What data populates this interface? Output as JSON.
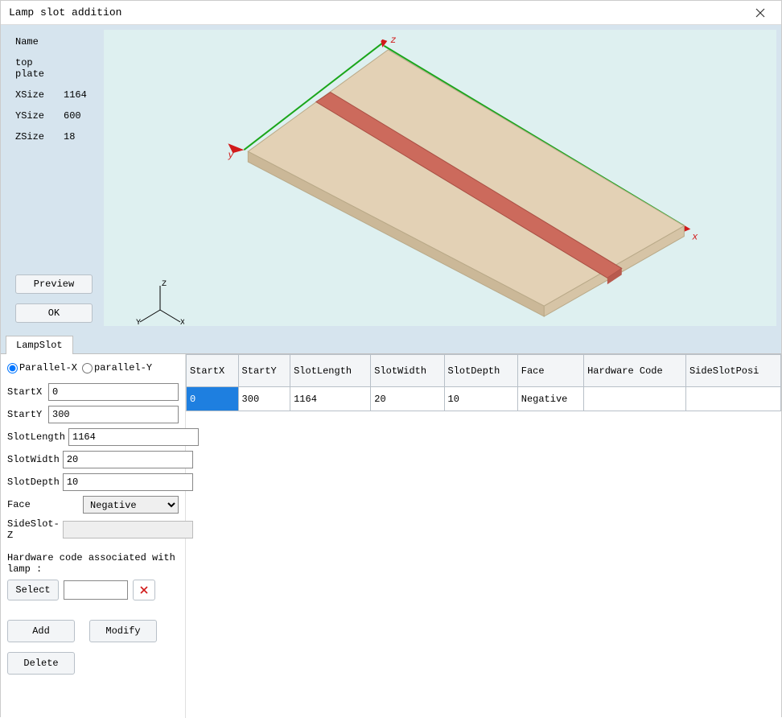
{
  "window": {
    "title": "Lamp slot addition"
  },
  "info": {
    "name_label": "Name",
    "name_value": "top plate",
    "xsize_label": "XSize",
    "xsize_value": "1164",
    "ysize_label": "YSize",
    "ysize_value": "600",
    "zsize_label": "ZSize",
    "zsize_value": "18",
    "preview_btn": "Preview",
    "ok_btn": "OK"
  },
  "axis": {
    "x": "X",
    "y": "Y",
    "z": "Z"
  },
  "tab": {
    "label": "LampSlot"
  },
  "radios": {
    "parallel_x": "Parallel-X",
    "parallel_y": "parallel-Y",
    "selected": "x"
  },
  "fields": {
    "startx_label": "StartX",
    "startx_value": "0",
    "starty_label": "StartY",
    "starty_value": "300",
    "slotlength_label": "SlotLength",
    "slotlength_value": "1164",
    "slotwidth_label": "SlotWidth",
    "slotwidth_value": "20",
    "slotdepth_label": "SlotDepth",
    "slotdepth_value": "10",
    "face_label": "Face",
    "face_value": "Negative",
    "sideslotz_label": "SideSlot-Z",
    "sideslotz_value": ""
  },
  "hardware": {
    "assoc_label": "Hardware code associated with lamp :",
    "select_btn": "Select",
    "code_value": ""
  },
  "buttons": {
    "add": "Add",
    "modify": "Modify",
    "delete": "Delete"
  },
  "table": {
    "headers": [
      "StartX",
      "StartY",
      "SlotLength",
      "SlotWidth",
      "SlotDepth",
      "Face",
      "Hardware Code",
      "SideSlotPosi"
    ],
    "rows": [
      {
        "cells": [
          "0",
          "300",
          "1164",
          "20",
          "10",
          "Negative",
          "",
          ""
        ],
        "selected_col": 0
      }
    ]
  },
  "colors": {
    "plate_top": "#e3d1b5",
    "plate_side": "#cbb898",
    "slot": "#cc6a5c",
    "axis_green": "#1aa61a",
    "axis_red": "#d11a1a",
    "sel_blue": "#1e7fe0"
  }
}
